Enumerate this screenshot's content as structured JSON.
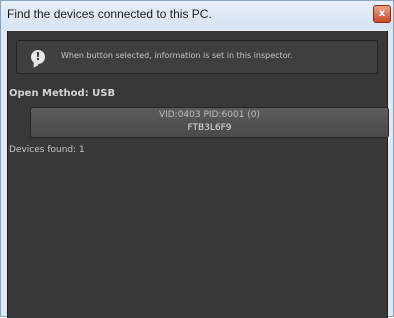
{
  "window": {
    "title": "Find the devices connected to this PC.",
    "close_glyph": "x"
  },
  "info": {
    "icon": "speech-bubble-exclamation-icon",
    "icon_glyph": "!",
    "message": "When button selected, information is set in this inspector."
  },
  "open_method": {
    "label": "Open Method: USB"
  },
  "devices": [
    {
      "line1": "VID:0403 PID:6001 (0)",
      "line2": "FTB3L6F9"
    }
  ],
  "status": {
    "devices_found": "Devices found: 1"
  },
  "colors": {
    "panel_bg": "#383838",
    "button_bg": "#555555",
    "titlebar_bg": "#dfe9f5",
    "close_button": "#c9472a"
  }
}
